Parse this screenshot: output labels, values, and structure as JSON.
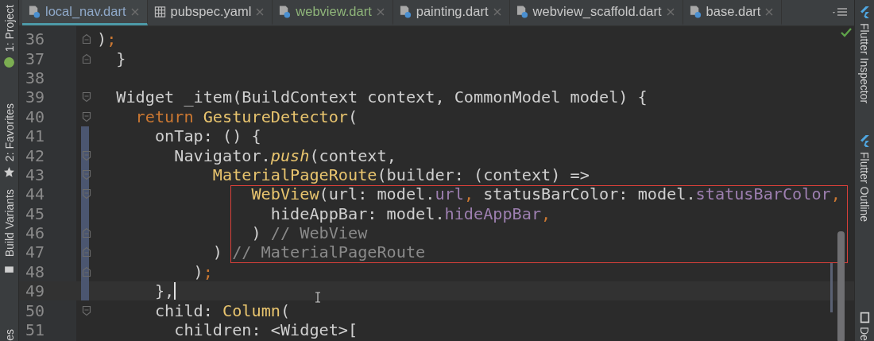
{
  "left_toolbar": [
    {
      "label": "1: Project"
    },
    {
      "label": "2: Favorites"
    },
    {
      "label": "Build Variants"
    },
    {
      "label": "es"
    }
  ],
  "tabs": [
    {
      "label": "local_nav.dart",
      "kind": "dart",
      "selected": true,
      "color": "#8fa8c8"
    },
    {
      "label": "pubspec.yaml",
      "kind": "yaml",
      "selected": false,
      "color": "#c8c8c8"
    },
    {
      "label": "webview.dart",
      "kind": "dart",
      "selected": false,
      "color": "#8fb57a"
    },
    {
      "label": "painting.dart",
      "kind": "dart",
      "selected": false,
      "color": "#c8c8c8"
    },
    {
      "label": "webview_scaffold.dart",
      "kind": "dart",
      "selected": false,
      "color": "#c8c8c8"
    },
    {
      "label": "base.dart",
      "kind": "dart",
      "selected": false,
      "color": "#c8c8c8"
    }
  ],
  "right_toolbar": [
    {
      "label": "Flutter Inspector"
    },
    {
      "label": "Flutter Outline"
    },
    {
      "label": "De"
    }
  ],
  "lines": [
    {
      "num": "36",
      "fold": {
        "kind": "end"
      },
      "changed": false,
      "current": false,
      "tokens": [
        {
          "text": ")",
          "kind": "plain"
        },
        {
          "text": ";",
          "kind": "punct"
        }
      ]
    },
    {
      "num": "37",
      "fold": {
        "kind": "end"
      },
      "changed": false,
      "current": false,
      "tokens": [
        {
          "text": "  }",
          "kind": "plain"
        }
      ]
    },
    {
      "num": "38",
      "changed": false,
      "current": false
    },
    {
      "num": "39",
      "fold": {
        "kind": "start"
      },
      "changed": false,
      "current": false,
      "tokens": [
        {
          "text": "  Widget _item(BuildContext context, CommonModel model) {",
          "kind": "plain"
        }
      ]
    },
    {
      "num": "40",
      "fold": {
        "kind": "start"
      },
      "changed": false,
      "current": false,
      "tokens": [
        {
          "text": "    return ",
          "kind": "keyword"
        },
        {
          "text": "GestureDetector",
          "kind": "class"
        },
        {
          "text": "(",
          "kind": "plain"
        }
      ]
    },
    {
      "num": "41",
      "changed": true,
      "current": false,
      "tokens": [
        {
          "text": "      onTap: () {",
          "kind": "plain"
        }
      ]
    },
    {
      "num": "42",
      "fold": {
        "kind": "start"
      },
      "changed": true,
      "current": false,
      "tokens": [
        {
          "text": "        Navigator.",
          "kind": "plain"
        },
        {
          "text": "push",
          "kind": "method"
        },
        {
          "text": "(context,",
          "kind": "plain"
        }
      ]
    },
    {
      "num": "43",
      "fold": {
        "kind": "start"
      },
      "changed": true,
      "current": false,
      "tokens": [
        {
          "text": "            MaterialPageRoute",
          "kind": "class"
        },
        {
          "text": "(builder: (context) =>",
          "kind": "plain"
        }
      ]
    },
    {
      "num": "44",
      "fold": {
        "kind": "start"
      },
      "changed": true,
      "current": false,
      "tokens": [
        {
          "text": "                WebView",
          "kind": "class"
        },
        {
          "text": "(url: model.",
          "kind": "plain"
        },
        {
          "text": "url",
          "kind": "field"
        },
        {
          "text": ",",
          "kind": "punct"
        },
        {
          "text": " statusBarColor: model.",
          "kind": "plain"
        },
        {
          "text": "statusBarColor",
          "kind": "field"
        },
        {
          "text": ",",
          "kind": "punct"
        }
      ]
    },
    {
      "num": "45",
      "changed": true,
      "current": false,
      "tokens": [
        {
          "text": "                  hideAppBar: model.",
          "kind": "plain"
        },
        {
          "text": "hideAppBar",
          "kind": "field"
        },
        {
          "text": ",",
          "kind": "punct"
        }
      ]
    },
    {
      "num": "46",
      "fold": {
        "kind": "end"
      },
      "changed": true,
      "current": false,
      "tokens": [
        {
          "text": "                ) ",
          "kind": "plain"
        },
        {
          "text": "// WebView",
          "kind": "comment"
        }
      ]
    },
    {
      "num": "47",
      "fold": {
        "kind": "end"
      },
      "changed": true,
      "current": false,
      "tokens": [
        {
          "text": "            ) ",
          "kind": "plain"
        },
        {
          "text": "// MaterialPageRoute",
          "kind": "comment"
        }
      ]
    },
    {
      "num": "48",
      "fold": {
        "kind": "end"
      },
      "changed": true,
      "current": false,
      "tokens": [
        {
          "text": "          )",
          "kind": "plain"
        },
        {
          "text": ";",
          "kind": "punct"
        }
      ]
    },
    {
      "num": "49",
      "changed": true,
      "current": true,
      "tokens": [
        {
          "text": "      },",
          "kind": "plain"
        }
      ]
    },
    {
      "num": "50",
      "fold": {
        "kind": "start"
      },
      "changed": false,
      "current": false,
      "tokens": [
        {
          "text": "      child: ",
          "kind": "plain"
        },
        {
          "text": "Column",
          "kind": "class"
        },
        {
          "text": "(",
          "kind": "plain"
        }
      ]
    },
    {
      "num": "51",
      "changed": false,
      "current": false,
      "tokens": [
        {
          "text": "        children: <Widget>[",
          "kind": "plain"
        }
      ]
    }
  ]
}
